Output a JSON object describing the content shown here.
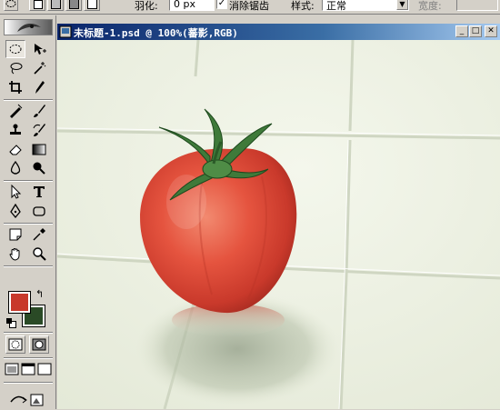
{
  "options_bar": {
    "feather_label": "羽化:",
    "feather_value": "0 px",
    "antialias_label": "消除锯齿",
    "antialias_checked": true,
    "style_label": "样式:",
    "style_value": "正常",
    "width_label": "宽度:"
  },
  "document": {
    "title": "未标题-1.psd @ 100%(蕃影,RGB)",
    "window_buttons": [
      "minimize",
      "maximize",
      "close"
    ]
  },
  "toolbox": {
    "tools": [
      "marquee-tool",
      "move-tool",
      "lasso-tool",
      "magic-wand-tool",
      "crop-tool",
      "slice-tool",
      "healing-brush-tool",
      "brush-tool",
      "clone-stamp-tool",
      "history-brush-tool",
      "eraser-tool",
      "gradient-tool",
      "blur-tool",
      "dodge-tool",
      "path-selection-tool",
      "type-tool",
      "pen-tool",
      "shape-tool",
      "notes-tool",
      "eyedropper-tool",
      "hand-tool",
      "zoom-tool"
    ],
    "foreground_color": "#c8382b",
    "background_color": "#2a4a26"
  },
  "colors": {
    "title_bar_start": "#0a246a",
    "title_bar_end": "#a6caf0",
    "ui_face": "#d4d0c8",
    "tile": "#eef2e4",
    "tomato": "#e5543f",
    "stem": "#3f7a3a"
  }
}
